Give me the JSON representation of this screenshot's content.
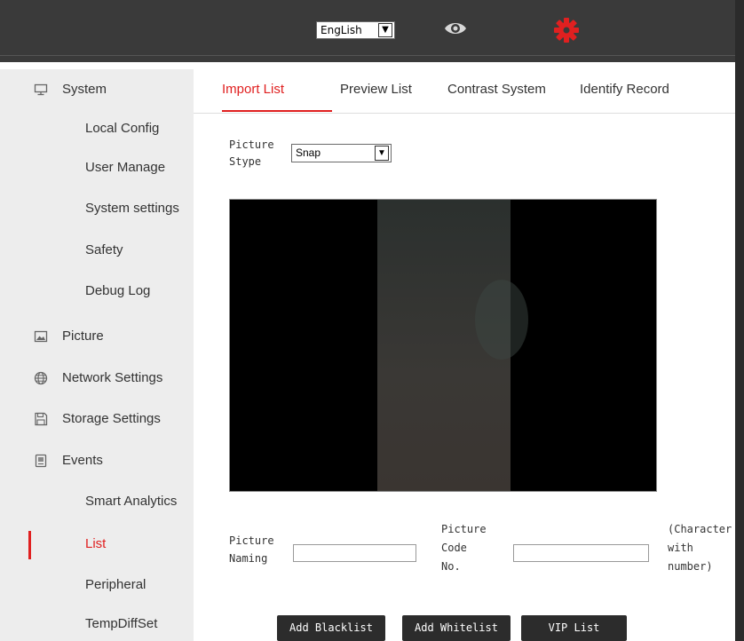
{
  "header": {
    "language": "EngLish",
    "icons": [
      "eye-icon",
      "gear-icon"
    ],
    "gear_color": "#e02020"
  },
  "sidebar": {
    "items": [
      {
        "label": "System",
        "icon": "monitor-icon",
        "level": "top"
      },
      {
        "label": "Local Config",
        "level": "sub"
      },
      {
        "label": "User Manage",
        "level": "sub"
      },
      {
        "label": "System settings",
        "level": "sub"
      },
      {
        "label": "Safety",
        "level": "sub"
      },
      {
        "label": "Debug Log",
        "level": "sub"
      },
      {
        "label": "Picture",
        "icon": "picture-icon",
        "level": "top"
      },
      {
        "label": "Network Settings",
        "icon": "globe-icon",
        "level": "top"
      },
      {
        "label": "Storage Settings",
        "icon": "save-icon",
        "level": "top"
      },
      {
        "label": "Events",
        "icon": "events-icon",
        "level": "top"
      },
      {
        "label": "Smart Analytics",
        "level": "sub"
      },
      {
        "label": "List",
        "level": "sub",
        "active": true
      },
      {
        "label": "Peripheral",
        "level": "sub"
      },
      {
        "label": "TempDiffSet",
        "level": "sub"
      }
    ]
  },
  "tabs": [
    {
      "label": "Import List",
      "active": true
    },
    {
      "label": "Preview List"
    },
    {
      "label": "Contrast System"
    },
    {
      "label": "Identify Record"
    }
  ],
  "form": {
    "picture_type_label": [
      "Picture",
      "Stype"
    ],
    "picture_type_value": "Snap",
    "picture_naming_label": [
      "Picture",
      "Naming"
    ],
    "picture_naming_value": "",
    "picture_code_label": [
      "Picture",
      "Code",
      "No."
    ],
    "picture_code_value": "",
    "code_note": [
      "(Character",
      "with",
      "number)"
    ]
  },
  "buttons": {
    "add_blacklist": "Add Blacklist",
    "add_whitelist": "Add Whitelist",
    "vip_list": "VIP List"
  },
  "colors": {
    "accent": "#e02020",
    "topbar": "#3a3a3a",
    "sidebar": "#ededed",
    "button": "#2c2c2c"
  }
}
